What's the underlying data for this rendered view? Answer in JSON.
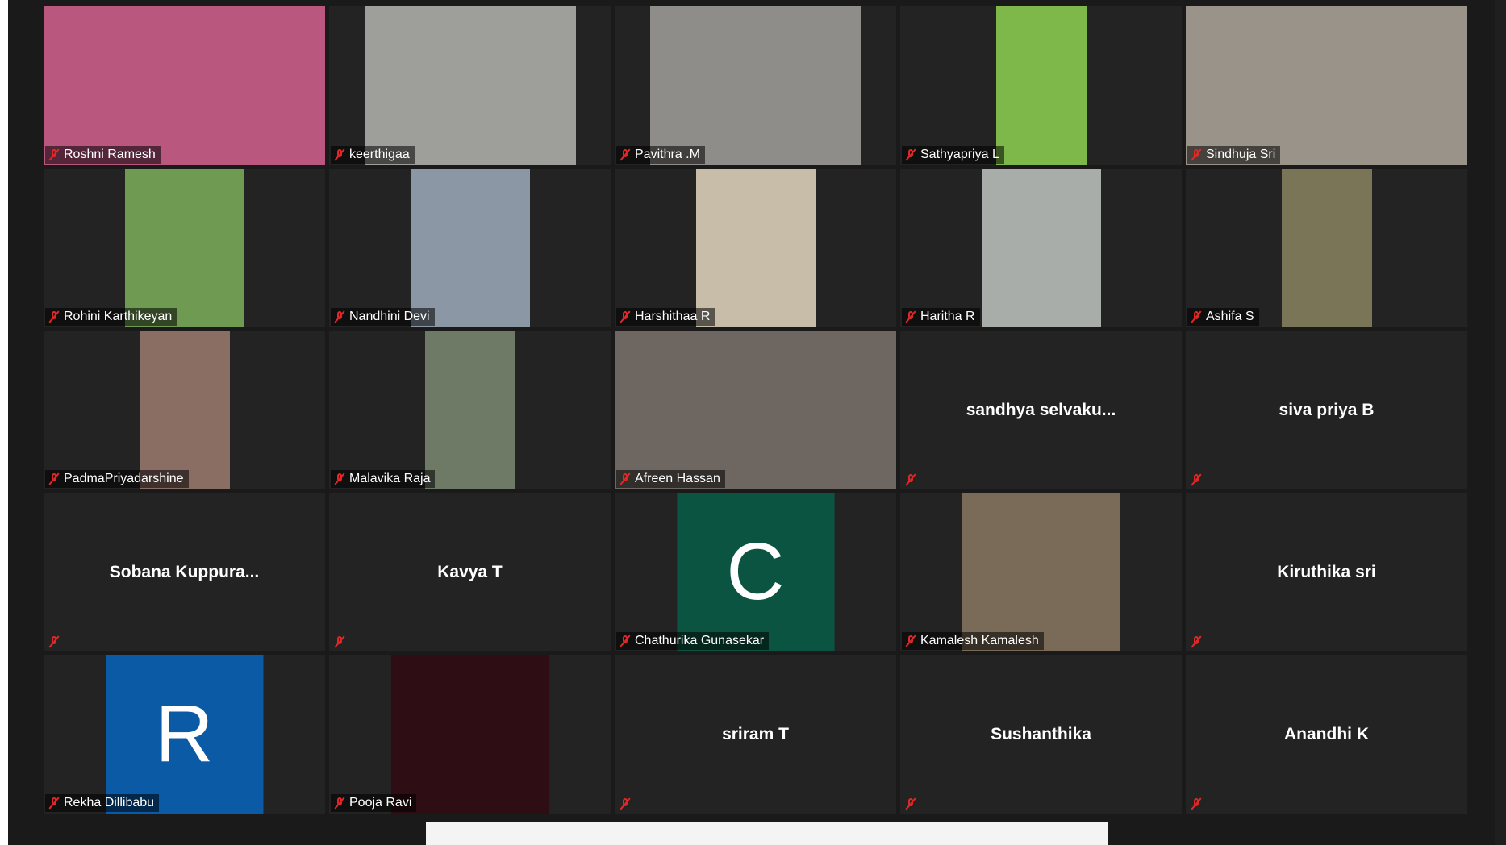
{
  "participants": [
    {
      "name": "Roshni Ramesh",
      "type": "video",
      "bg": "#b9577f",
      "w": "full"
    },
    {
      "name": "keerthigaa",
      "type": "video",
      "bg": "#9e9e9a",
      "w": 262
    },
    {
      "name": "Pavithra .M",
      "type": "video",
      "bg": "#8f8d8a",
      "w": 262
    },
    {
      "name": "Sathyapriya L",
      "type": "video",
      "bg": "#7fb84a",
      "w": 112
    },
    {
      "name": "Sindhuja Sri",
      "type": "video",
      "bg": "#9a938a",
      "w": "full"
    },
    {
      "name": "Rohini Karthikeyan",
      "type": "video",
      "bg": "#6f9a52",
      "w": 148
    },
    {
      "name": "Nandhini Devi",
      "type": "video",
      "bg": "#8b97a5",
      "w": 148
    },
    {
      "name": "Harshithaa R",
      "type": "video",
      "bg": "#c8bda8",
      "w": 148
    },
    {
      "name": "Haritha R",
      "type": "video",
      "bg": "#a9adaa",
      "w": 148
    },
    {
      "name": "Ashifa S",
      "type": "video",
      "bg": "#7a7557",
      "w": 112
    },
    {
      "name": "PadmaPriyadarshine",
      "type": "video",
      "bg": "#8a6e64",
      "w": 112
    },
    {
      "name": "Malavika Raja",
      "type": "video",
      "bg": "#6e7a66",
      "w": 112
    },
    {
      "name": "Afreen Hassan",
      "type": "video",
      "bg": "#6e6660",
      "w": "full"
    },
    {
      "name": "sandhya  selvaku...",
      "type": "text"
    },
    {
      "name": "siva priya B",
      "type": "text"
    },
    {
      "name": "Sobana  Kuppura...",
      "type": "text"
    },
    {
      "name": "Kavya T",
      "type": "text"
    },
    {
      "name": "Chathurika Gunasekar",
      "type": "letter",
      "letter": "C",
      "bg": "#0b5442"
    },
    {
      "name": "Kamalesh Kamalesh",
      "type": "video",
      "bg": "#7a6a58",
      "w": 196
    },
    {
      "name": "Kiruthika sri",
      "type": "text"
    },
    {
      "name": "Rekha Dillibabu",
      "type": "letter",
      "letter": "R",
      "bg": "#0b5aa6"
    },
    {
      "name": "Pooja Ravi",
      "type": "video",
      "bg": "#2e0d14",
      "w": 196
    },
    {
      "name": "sriram T",
      "type": "text"
    },
    {
      "name": "Sushanthika",
      "type": "text"
    },
    {
      "name": "Anandhi K",
      "type": "text"
    }
  ]
}
